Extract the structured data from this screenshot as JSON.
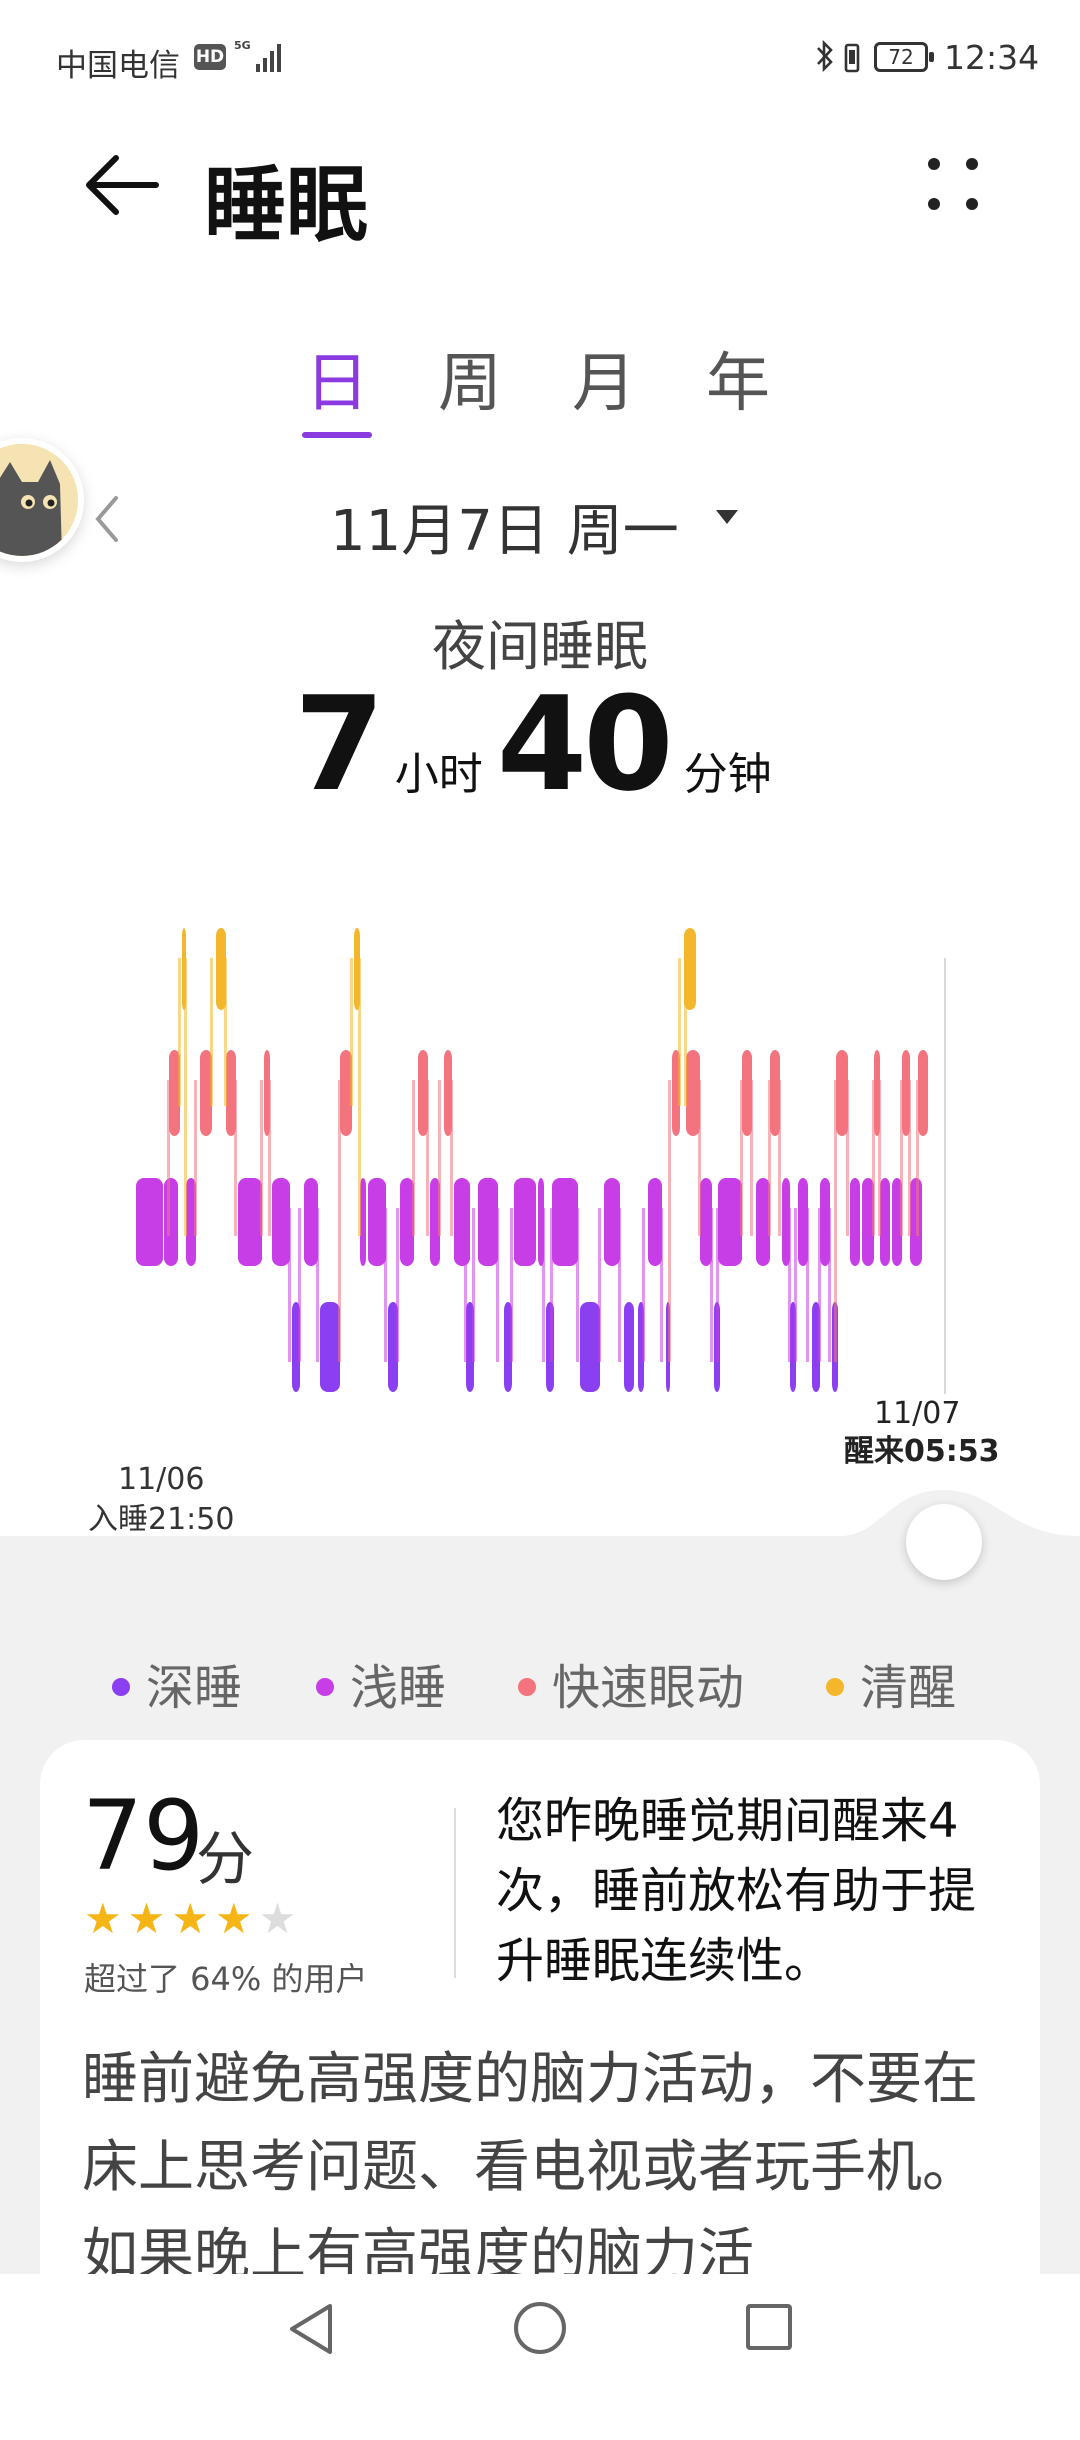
{
  "status_bar": {
    "carrier": "中国电信",
    "hd_badge": "HD",
    "network": "5G",
    "battery": "72",
    "time": "12:34"
  },
  "header": {
    "title": "睡眠",
    "back_icon": "arrow-left-icon",
    "more_icon": "more-dots-icon"
  },
  "tabs": [
    {
      "label": "日",
      "active": true
    },
    {
      "label": "周",
      "active": false
    },
    {
      "label": "月",
      "active": false
    },
    {
      "label": "年",
      "active": false
    }
  ],
  "date_selector": {
    "prev_icon": "chevron-left-icon",
    "date": "11月7日 周一",
    "dropdown_icon": "caret-down-icon"
  },
  "summary": {
    "label": "夜间睡眠",
    "hours": "7",
    "hours_unit": "小时",
    "minutes": "40",
    "minutes_unit": "分钟"
  },
  "chart": {
    "start_date": "11/06",
    "start_time": "入睡21:50",
    "end_date": "11/07",
    "end_time": "醒来05:53",
    "colors": {
      "deep": "#8a3ff0",
      "light": "#c83ee6",
      "rem": "#f3747f",
      "awake": "#f4b62a"
    }
  },
  "legend": [
    {
      "label": "深睡",
      "color": "#8a3ff0"
    },
    {
      "label": "浅睡",
      "color": "#c83ee6"
    },
    {
      "label": "快速眼动",
      "color": "#f3747f"
    },
    {
      "label": "清醒",
      "color": "#f4b62a"
    }
  ],
  "score_card": {
    "score": "79",
    "score_unit": "分",
    "stars_filled": 4,
    "stars_total": 5,
    "beat_text": "超过了 64% 的用户",
    "insight": "您昨晚睡觉期间醒来4 次，睡前放松有助于提升睡眠连续性。",
    "advice": "睡前避免高强度的脑力活动，不要在床上思考问题、看电视或者玩手机。如果晚上有高强度的脑力活"
  },
  "nav_bar": {
    "back_icon": "nav-back-icon",
    "home_icon": "nav-home-icon",
    "recent_icon": "nav-recent-icon"
  }
}
